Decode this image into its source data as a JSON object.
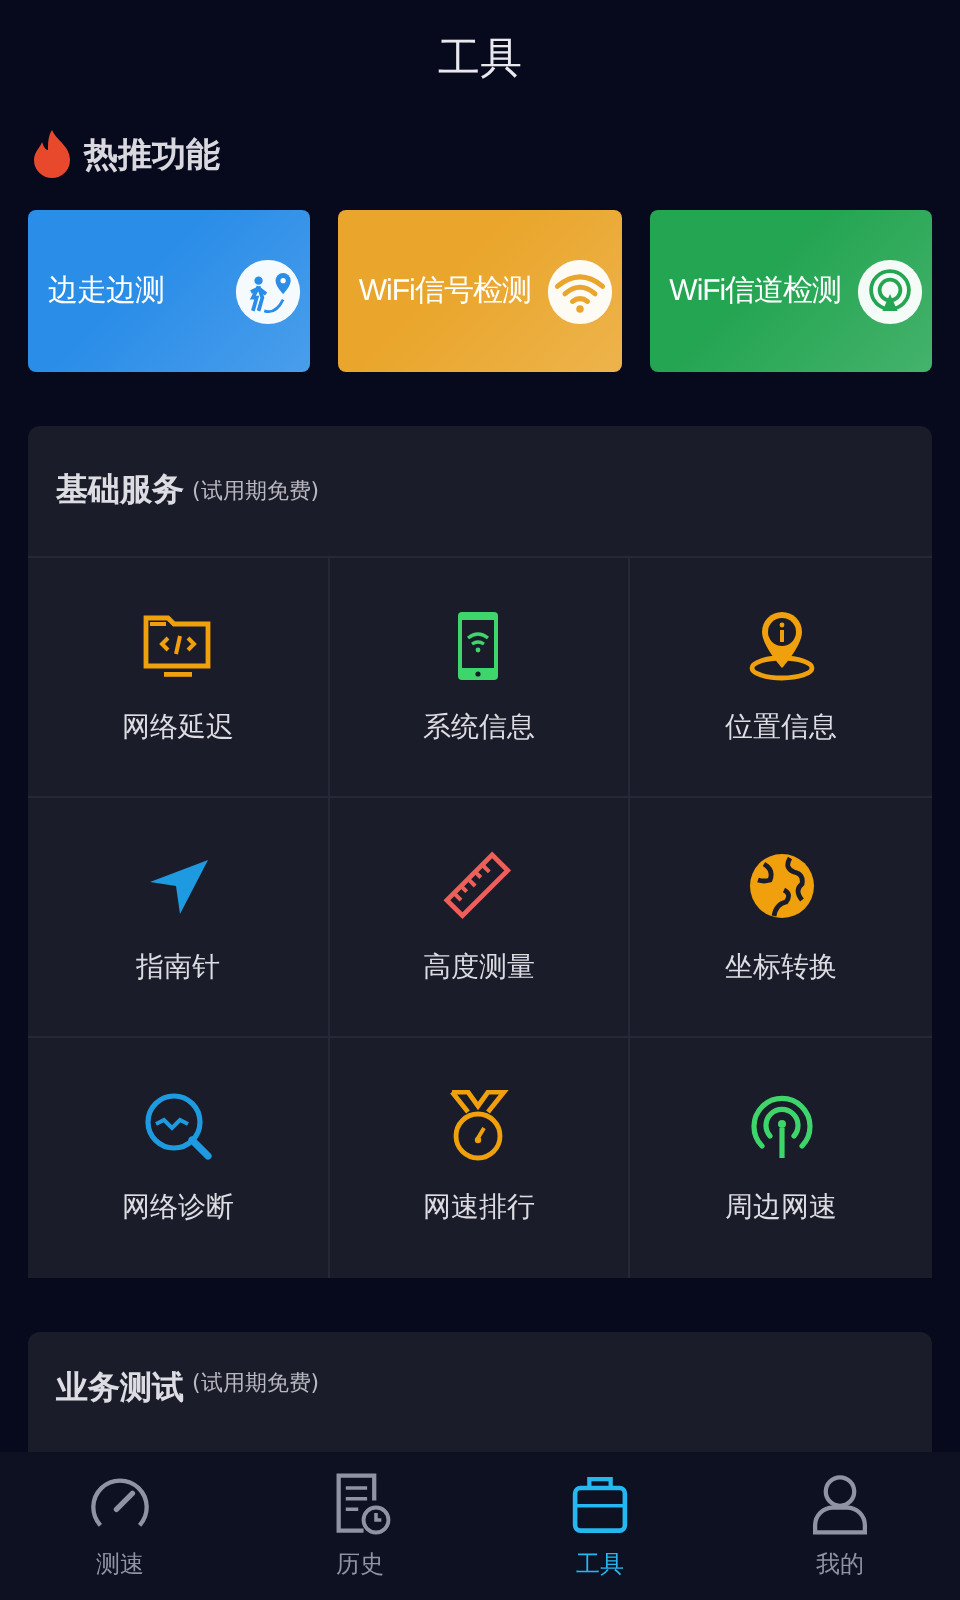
{
  "header": {
    "title": "工具"
  },
  "hot": {
    "title": "热推功能",
    "cards": [
      {
        "label": "边走边测",
        "kind": "walk",
        "color": "#2a8de8"
      },
      {
        "label": "WiFi信号检测",
        "kind": "wifi",
        "color": "#eaa62c"
      },
      {
        "label": "WiFi信道检测",
        "kind": "channel",
        "color": "#24a552"
      }
    ]
  },
  "basic": {
    "title": "基础服务",
    "note": "(试用期免费)",
    "items": [
      {
        "label": "网络延迟",
        "kind": "code"
      },
      {
        "label": "系统信息",
        "kind": "phone"
      },
      {
        "label": "位置信息",
        "kind": "pin"
      },
      {
        "label": "指南针",
        "kind": "compass"
      },
      {
        "label": "高度测量",
        "kind": "ruler"
      },
      {
        "label": "坐标转换",
        "kind": "globe"
      },
      {
        "label": "网络诊断",
        "kind": "diagnose"
      },
      {
        "label": "网速排行",
        "kind": "medal"
      },
      {
        "label": "周边网速",
        "kind": "signal"
      }
    ]
  },
  "business": {
    "title": "业务测试",
    "note": "(试用期免费)"
  },
  "nav": [
    {
      "label": "测速",
      "kind": "speed",
      "selected": false
    },
    {
      "label": "历史",
      "kind": "history",
      "selected": false
    },
    {
      "label": "工具",
      "kind": "tools",
      "selected": true
    },
    {
      "label": "我的",
      "kind": "me",
      "selected": false
    }
  ]
}
